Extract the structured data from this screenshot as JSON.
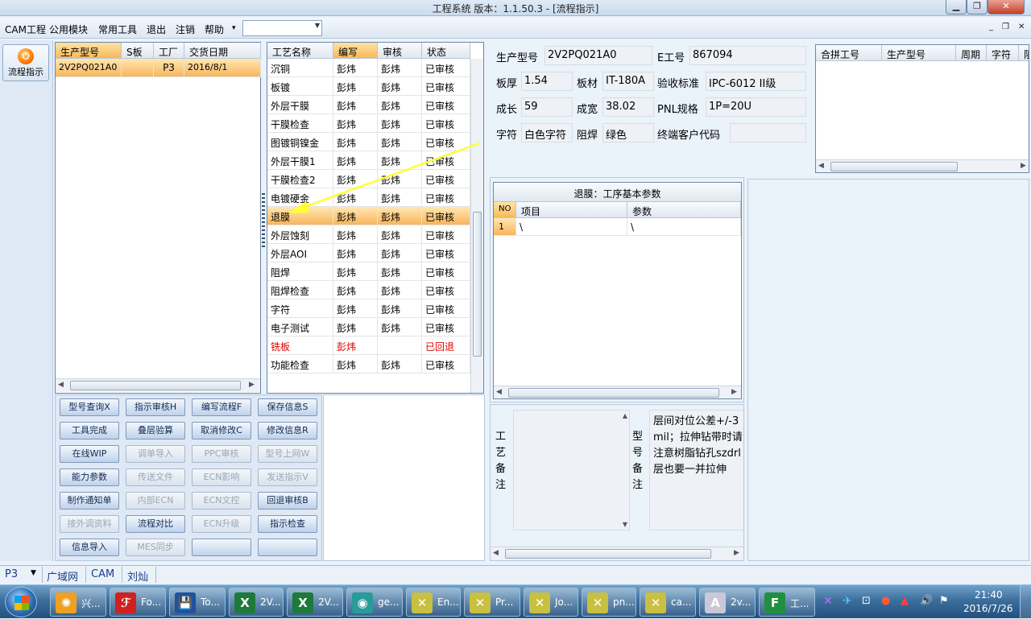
{
  "window": {
    "title": "工程系统   版本：1.1.50.3 - [流程指示]"
  },
  "menu": {
    "items": [
      "CAM工程",
      "公用模块",
      "常用工具",
      "退出",
      "注销",
      "帮助"
    ],
    "help_arrow": "▾",
    "combo_value": ""
  },
  "side": {
    "flow_label": "流程指示"
  },
  "products": {
    "columns": [
      "生产型号",
      "S板",
      "工厂",
      "交货日期"
    ],
    "rows": [
      [
        "2V2PQ021A0",
        "",
        "P3",
        "2016/8/1"
      ]
    ]
  },
  "process": {
    "columns": [
      "工艺名称",
      "编写",
      "审核",
      "状态"
    ],
    "rows": [
      [
        "沉铜",
        "彭炜",
        "彭炜",
        "已审核"
      ],
      [
        "板镀",
        "彭炜",
        "彭炜",
        "已审核"
      ],
      [
        "外层干膜",
        "彭炜",
        "彭炜",
        "已审核"
      ],
      [
        "干膜检查",
        "彭炜",
        "彭炜",
        "已审核"
      ],
      [
        "图镀铜镍金",
        "彭炜",
        "彭炜",
        "已审核"
      ],
      [
        "外层干膜1",
        "彭炜",
        "彭炜",
        "已审核"
      ],
      [
        "干膜检查2",
        "彭炜",
        "彭炜",
        "已审核"
      ],
      [
        "电镀硬金",
        "彭炜",
        "彭炜",
        "已审核"
      ],
      [
        "退膜",
        "彭炜",
        "彭炜",
        "已审核"
      ],
      [
        "外层蚀刻",
        "彭炜",
        "彭炜",
        "已审核"
      ],
      [
        "外层AOI",
        "彭炜",
        "彭炜",
        "已审核"
      ],
      [
        "阻焊",
        "彭炜",
        "彭炜",
        "已审核"
      ],
      [
        "阻焊检查",
        "彭炜",
        "彭炜",
        "已审核"
      ],
      [
        "字符",
        "彭炜",
        "彭炜",
        "已审核"
      ],
      [
        "电子测试",
        "彭炜",
        "彭炜",
        "已审核"
      ],
      [
        "铣板",
        "彭炜",
        "",
        "已回退"
      ],
      [
        "功能检查",
        "彭炜",
        "彭炜",
        "已审核"
      ]
    ],
    "selected_index": 8,
    "red_index": 15
  },
  "buttons": [
    {
      "label": "型号查询X",
      "enabled": true
    },
    {
      "label": "指示审核H",
      "enabled": true
    },
    {
      "label": "编写流程F",
      "enabled": true
    },
    {
      "label": "保存信息S",
      "enabled": true
    },
    {
      "label": "工具完成",
      "enabled": true
    },
    {
      "label": "叠层验算",
      "enabled": true
    },
    {
      "label": "取消修改C",
      "enabled": true
    },
    {
      "label": "修改信息R",
      "enabled": true
    },
    {
      "label": "在线WIP",
      "enabled": true
    },
    {
      "label": "调单导入",
      "enabled": false
    },
    {
      "label": "PPC审核",
      "enabled": false
    },
    {
      "label": "型号上网W",
      "enabled": false
    },
    {
      "label": "能力参数",
      "enabled": true
    },
    {
      "label": "传送文件",
      "enabled": false
    },
    {
      "label": "ECN影响",
      "enabled": false
    },
    {
      "label": "发送指示V",
      "enabled": false
    },
    {
      "label": "制作通知单",
      "enabled": true
    },
    {
      "label": "内部ECN",
      "enabled": false
    },
    {
      "label": "ECN文控",
      "enabled": false
    },
    {
      "label": "回退审核B",
      "enabled": true
    },
    {
      "label": "接外调资料",
      "enabled": false
    },
    {
      "label": "流程对比",
      "enabled": true
    },
    {
      "label": "ECN升级",
      "enabled": false
    },
    {
      "label": "指示检查",
      "enabled": true
    },
    {
      "label": "信息导入",
      "enabled": true
    },
    {
      "label": "MES同步",
      "enabled": false
    },
    {
      "label": "",
      "enabled": true
    },
    {
      "label": "",
      "enabled": true
    }
  ],
  "info": {
    "product_model_label": "生产型号",
    "product_model": "2V2PQ021A0",
    "e_code_label": "E工号",
    "e_code": "867094",
    "thickness_label": "板厚",
    "thickness": "1.54",
    "material_label": "板材",
    "material": "IT-180A",
    "standard_label": "验收标准",
    "standard": "IPC-6012 II级",
    "length_label": "成长",
    "length": "59",
    "width_label": "成宽",
    "width": "38.02",
    "pnl_label": "PNL规格",
    "pnl": "1P=20U",
    "silk_label": "字符",
    "silk": "白色字符",
    "mask_label": "阻焊",
    "mask": "绿色",
    "customer_label": "终端客户代码",
    "customer": ""
  },
  "merge": {
    "columns": [
      "合拼工号",
      "生产型号",
      "周期",
      "字符",
      "阻焊"
    ]
  },
  "params": {
    "title": "退膜：工序基本参数",
    "columns": [
      "NO",
      "项目",
      "参数"
    ],
    "rows": [
      [
        "1",
        "\\",
        "\\"
      ]
    ]
  },
  "remarks": {
    "process_label": "工艺备注",
    "model_label": "型号备注",
    "model_text": "层间对位公差+/-3mil；拉伸钻带时请注意树脂钻孔szdrl层也要一并拉伸"
  },
  "statusbar": {
    "factory": "P3",
    "network": "广域网",
    "dept": "CAM",
    "user": "刘灿"
  },
  "taskbar": {
    "tasks": [
      "兴...",
      "Fo...",
      "To...",
      "2V...",
      "2V...",
      "ge...",
      "En...",
      "Pr...",
      "Jo...",
      "pn...",
      "ca...",
      "2v...",
      "工..."
    ],
    "time": "21:40",
    "date": "2016/7/26"
  }
}
